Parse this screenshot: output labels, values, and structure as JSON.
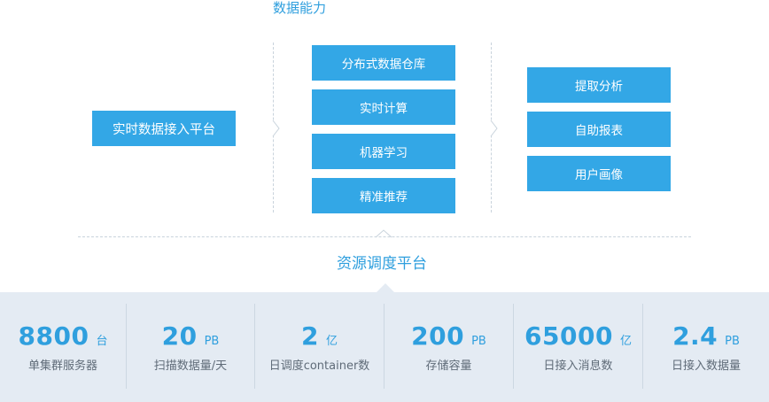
{
  "header": {
    "title": "数据能力"
  },
  "diagram": {
    "left_box": "实时数据接入平台",
    "middle_boxes": [
      "分布式数据仓库",
      "实时计算",
      "机器学习",
      "精准推荐"
    ],
    "right_boxes": [
      "提取分析",
      "自助报表",
      "用户画像"
    ],
    "bottom_title": "资源调度平台"
  },
  "stats": [
    {
      "value": "8800",
      "unit": "台",
      "label": "单集群服务器"
    },
    {
      "value": "20",
      "unit": "PB",
      "label": "扫描数据量/天"
    },
    {
      "value": "2",
      "unit": "亿",
      "label": "日调度container数"
    },
    {
      "value": "200",
      "unit": "PB",
      "label": "存储容量"
    },
    {
      "value": "65000",
      "unit": "亿",
      "label": "日接入消息数"
    },
    {
      "value": "2.4",
      "unit": "PB",
      "label": "日接入数据量"
    }
  ],
  "colors": {
    "accent": "#33a7e6",
    "title": "#2f9fde",
    "stats_bg": "#e4ebf3",
    "label": "#5f6b78",
    "dashed": "#c9d3dc"
  }
}
